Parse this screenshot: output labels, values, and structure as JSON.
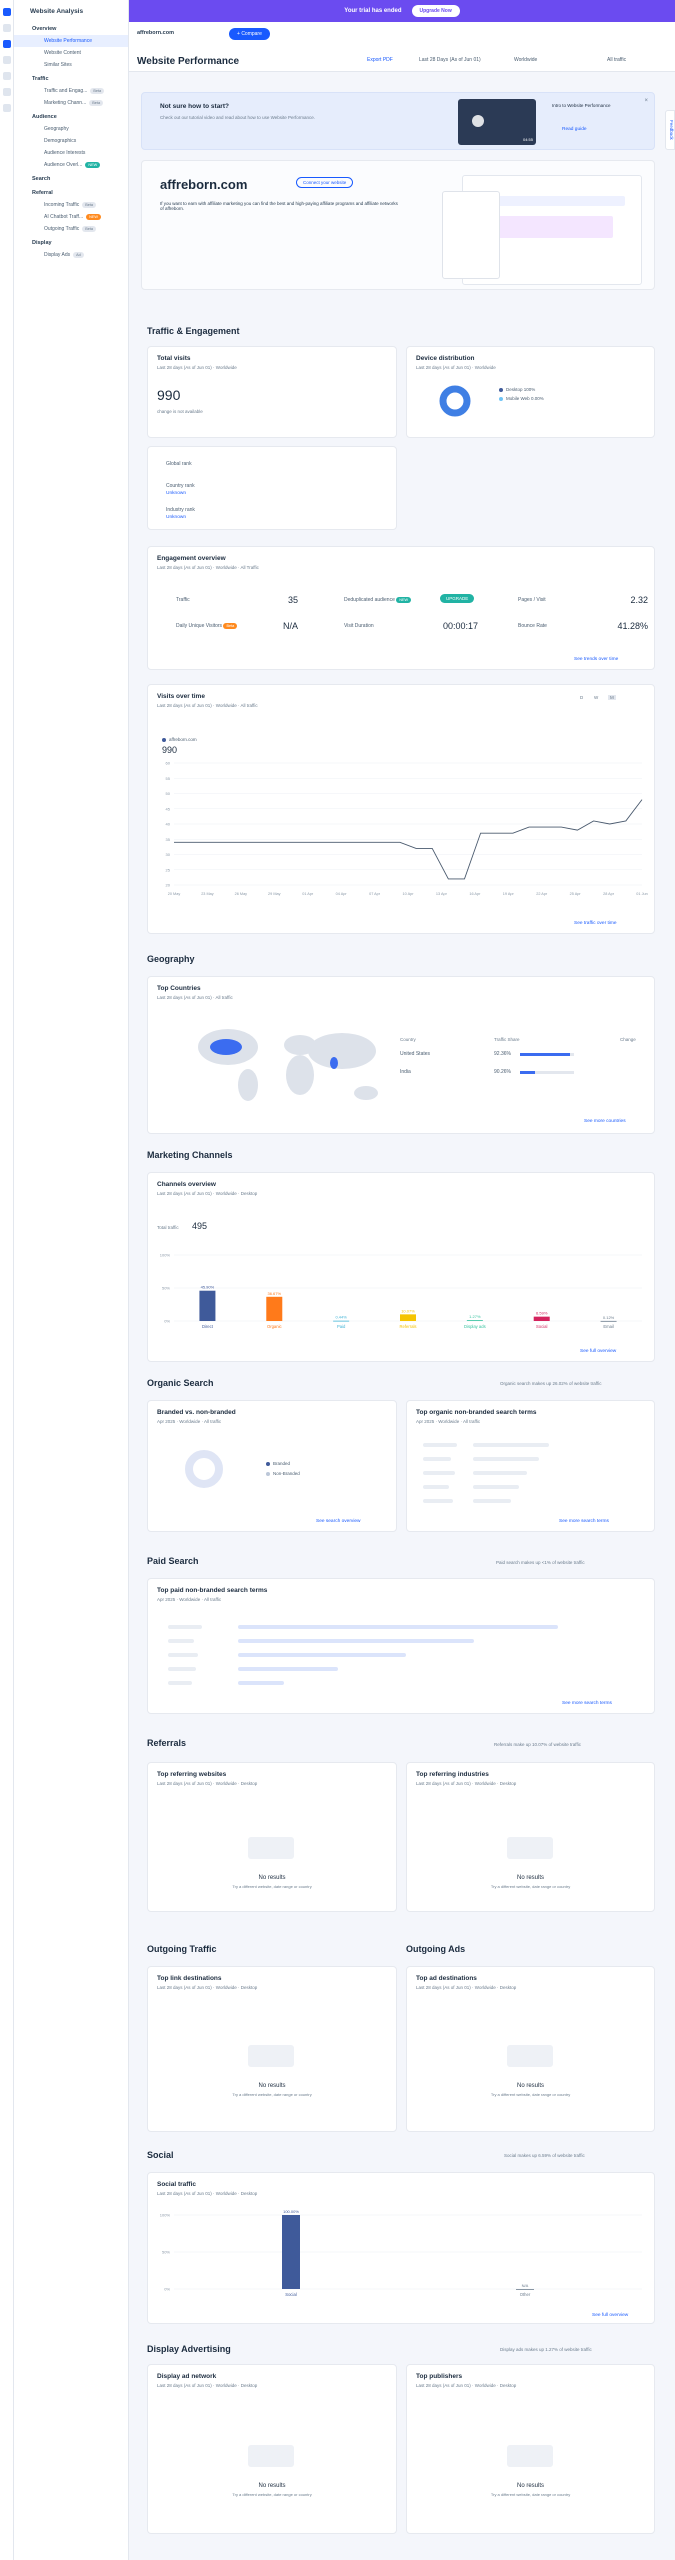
{
  "sidebar": {
    "title": "Website Analysis",
    "overview": "Overview",
    "website_performance": "Website Performance",
    "website_content": "Website Content",
    "similar_sites": "Similar Sites",
    "traffic": "Traffic",
    "traffic_engagement": "Traffic and Engag...",
    "marketing_channels": "Marketing Chann...",
    "audience": "Audience",
    "geography": "Geography",
    "demographics": "Demographics",
    "audience_interests": "Audience Interests",
    "audience_overlap": "Audience Overl...",
    "search": "Search",
    "referral": "Referral",
    "incoming_traffic": "Incoming Traffic",
    "ai_chatbot": "AI Chatbot Traff...",
    "outgoing_traffic": "Outgoing Traffic",
    "display": "Display",
    "display_ads": "Display Ads",
    "badge_new": "NEW",
    "badge_beta": "Beta",
    "badge_pill": "Ad"
  },
  "topbar": {
    "trial": "Your trial has ended",
    "upgrade": "Upgrade Now"
  },
  "header": {
    "domain": "affreborn.com",
    "compare": "Compare",
    "title": "Website Performance",
    "export": "Export PDF",
    "date": "Last 28 Days (As of Jun 01)",
    "geo": "Worldwide",
    "traffic": "All traffic"
  },
  "intro": {
    "title": "Not sure how to start?",
    "text": "Check out our tutorial video and read about how to use Website Performance.",
    "video": "Intro to Website Performance",
    "read": "Read guide",
    "time": "04:55"
  },
  "affiliate": {
    "domain": "affreborn.com",
    "connect": "Connect your website",
    "text": "If you want to earn with affiliate marketing you can find the best and high-paying affiliate programs and affiliate networks of affreborn."
  },
  "sections": {
    "traffic": "Traffic & Engagement",
    "geography": "Geography",
    "marketing": "Marketing Channels",
    "organic": "Organic Search",
    "paid": "Paid Search",
    "referrals": "Referrals",
    "outgoing": "Outgoing Traffic",
    "ads": "Outgoing Ads",
    "social": "Social",
    "display": "Display Advertising"
  },
  "total_visits": {
    "title": "Total visits",
    "sub": "Last 28 days (As of Jun 01)",
    "geo": "Worldwide",
    "value": "990",
    "note": "change is not available"
  },
  "device": {
    "title": "Device distribution",
    "sub": "Last 28 days (As of Jun 01)",
    "geo": "Worldwide",
    "desktop": "Desktop",
    "desktop_pct": "100%",
    "mobile": "Mobile Web",
    "mobile_pct": "0.00%"
  },
  "ranks": {
    "global": "Global rank",
    "country": "Country rank",
    "country_sub": "Unknown",
    "industry": "Industry rank",
    "industry_sub": "Unknown"
  },
  "engagement": {
    "title": "Engagement overview",
    "sub": "Last 28 days (As of Jun 01)",
    "geo": "Worldwide",
    "traffic_type": "All Traffic",
    "traffic": "Traffic",
    "traffic_val": "35",
    "dedup": "Deduplicated audience",
    "dedup_badge": "NEW",
    "upgrade": "UPGRADE",
    "pages": "Pages / Visit",
    "pages_val": "2.32",
    "dau": "Daily Unique Visitors",
    "dau_badge": "Beta",
    "dau_val": "N/A",
    "duration": "Visit Duration",
    "duration_val": "00:00:17",
    "bounce": "Bounce Rate",
    "bounce_val": "41.28%",
    "link": "See trends over time"
  },
  "visits_chart": {
    "title": "Visits over time",
    "sub": "Last 28 days (As of Jun 01)",
    "geo": "Worldwide",
    "traffic_type": "All traffic",
    "legend": "affreborn.com",
    "legend_val": "990",
    "link": "See traffic over time",
    "d": "D",
    "w": "W",
    "m": "M"
  },
  "countries": {
    "title": "Top Countries",
    "sub": "Last 28 days (As of Jun 01)",
    "traffic": "All traffic",
    "col_country": "Country",
    "col_share": "Traffic Share",
    "col_change": "Change",
    "rows": [
      {
        "name": "United States",
        "share": "92.36%"
      },
      {
        "name": "India",
        "share": "90.26%"
      }
    ],
    "link": "See more countries"
  },
  "channels": {
    "title": "Channels overview",
    "sub": "Last 28 days (As of Jun 01)",
    "geo": "Worldwide",
    "device": "Desktop",
    "total_label": "Total traffic",
    "total_val": "495",
    "link": "See full overview"
  },
  "organic": {
    "note": "Organic search makes up 26.02% of website traffic",
    "branded_title": "Branded vs. non-branded",
    "branded_sub": "Apr 2025",
    "geo": "Worldwide",
    "traffic": "All traffic",
    "branded": "Branded",
    "non_branded": "Non-Branded",
    "branded_link": "See search overview",
    "terms_title": "Top organic non-branded search terms",
    "terms_sub": "Apr 2025",
    "terms_link": "See more search terms"
  },
  "paid": {
    "note": "Paid search makes up <1% of website traffic",
    "terms_title": "Top paid non-branded search terms",
    "terms_sub": "Apr 2025",
    "geo": "Worldwide",
    "traffic": "All traffic",
    "link": "See more search terms"
  },
  "referrals": {
    "note": "Referrals make up 10.07% of website traffic",
    "web_title": "Top referring websites",
    "ind_title": "Top referring industries",
    "sub": "Last 28 days (As of Jun 01)",
    "geo": "Worldwide",
    "device": "Desktop",
    "nores": "No results",
    "nores_sub": "Try a different website, date range or country"
  },
  "outgoing": {
    "links_title": "Top link destinations",
    "ads_title": "Top ad destinations",
    "sub": "Last 28 days (As of Jun 01)",
    "geo": "Worldwide",
    "device": "Desktop",
    "nores": "No results",
    "nores_sub": "Try a different website, date range or country"
  },
  "social": {
    "note": "Social makes up 6.59% of website traffic",
    "title": "Social traffic",
    "sub": "Last 28 days (As of Jun 01)",
    "geo": "Worldwide",
    "device": "Desktop",
    "link": "See full overview"
  },
  "display": {
    "note": "Display ads makes up 1.27% of website traffic",
    "network_title": "Display ad network",
    "publishers_title": "Top publishers",
    "sub": "Last 28 days (As of Jun 01)",
    "geo": "Worldwide",
    "device": "Desktop",
    "nores": "No results",
    "nores_sub": "Try a different website, date range or country"
  },
  "feedback": "Feedback",
  "chart_data": [
    {
      "type": "line",
      "title": "Visits over time",
      "series": [
        {
          "name": "affreborn.com",
          "values": [
            34,
            34,
            34,
            34,
            34,
            34,
            34,
            34,
            34,
            34,
            34,
            34,
            34,
            34,
            34,
            32,
            32,
            22,
            22,
            37,
            37,
            37,
            39,
            39,
            39,
            38,
            41,
            40,
            41,
            48
          ]
        }
      ],
      "x": [
        "20 May",
        "23 May",
        "26 May",
        "29 May",
        "01 Apr",
        "04 Apr",
        "07 Apr",
        "10 Apr",
        "13 Apr",
        "16 Apr",
        "19 Apr",
        "22 Apr",
        "25 Apr",
        "28 Apr",
        "01 Jun"
      ],
      "ylim": [
        20,
        60
      ],
      "yticks": [
        20,
        25,
        30,
        35,
        40,
        45,
        50,
        55,
        60
      ]
    },
    {
      "type": "bar",
      "title": "Channels overview",
      "categories": [
        "Direct",
        "Organic",
        "Paid",
        "Referrals",
        "Display ads",
        "Social",
        "Email"
      ],
      "values": [
        45.9,
        36.67,
        0.44,
        10.07,
        1.27,
        6.59,
        0.12
      ],
      "labels": [
        "45.90%",
        "36.67%",
        "0.44%",
        "10.07%",
        "1.27%",
        "6.59%",
        "0.12%"
      ],
      "colors": [
        "#3f5a9a",
        "#ff7a1a",
        "#42b4d6",
        "#f5c400",
        "#37c3a0",
        "#d4235d",
        "#6b7c8d"
      ],
      "ylim": [
        0,
        100
      ],
      "yticks": [
        "100%",
        "50%",
        "0%"
      ]
    },
    {
      "type": "bar",
      "title": "Social traffic",
      "categories": [
        "Social",
        "Other"
      ],
      "values": [
        100,
        0
      ],
      "labels": [
        "100.00%",
        "N/A"
      ],
      "colors": [
        "#3f5a9a",
        "#6b7c8d"
      ],
      "ylim": [
        0,
        100
      ],
      "yticks": [
        "100%",
        "50%",
        "0%"
      ]
    }
  ]
}
